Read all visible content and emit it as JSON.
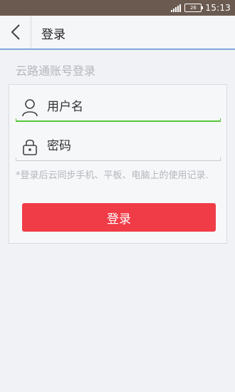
{
  "status_bar": {
    "time": "15:13",
    "battery_label": "26",
    "icons": [
      "signal-icon",
      "battery-icon"
    ]
  },
  "header": {
    "back_icon": "chevron-left-icon",
    "title": "登录"
  },
  "login": {
    "section_title": "云路通账号登录",
    "username": {
      "placeholder": "用户名",
      "value": "",
      "icon": "user-icon"
    },
    "password": {
      "placeholder": "密码",
      "value": "",
      "icon": "lock-icon"
    },
    "hint": "*登录后云同步手机、平板、电脑上的使用记录.",
    "submit_label": "登录"
  },
  "colors": {
    "status_bar": "#6b5a50",
    "accent_blue": "#7fa7dc",
    "focus_green": "#59c63d",
    "button_red": "#f03c47",
    "muted_text": "#b3b6bc"
  }
}
